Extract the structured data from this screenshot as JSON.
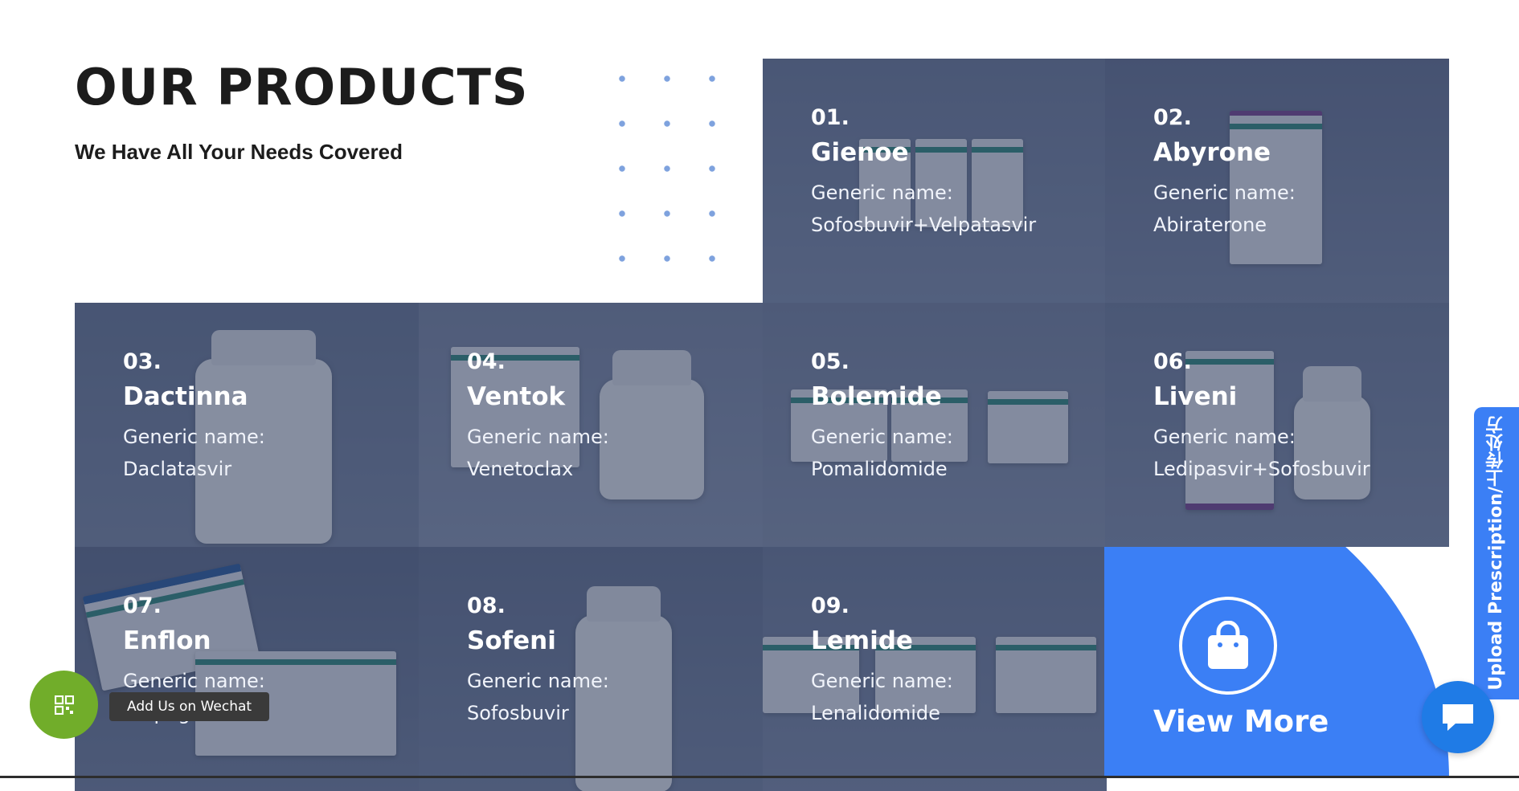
{
  "header": {
    "title": "OUR PRODUCTS",
    "subtitle": "We Have All Your Needs Covered"
  },
  "products": [
    {
      "num": "01.",
      "name": "Gienoe",
      "generic_label": "Generic name:",
      "generic": "Sofosbuvir+Velpatasvir"
    },
    {
      "num": "02.",
      "name": "Abyrone",
      "generic_label": "Generic name:",
      "generic": "Abiraterone"
    },
    {
      "num": "03.",
      "name": "Dactinna",
      "generic_label": "Generic name:",
      "generic": "Daclatasvir"
    },
    {
      "num": "04.",
      "name": "Ventok",
      "generic_label": "Generic name:",
      "generic": "Venetoclax"
    },
    {
      "num": "05.",
      "name": "Bolemide",
      "generic_label": "Generic name:",
      "generic": "Pomalidomide"
    },
    {
      "num": "06.",
      "name": "Liveni",
      "generic_label": "Generic name:",
      "generic": "Ledipasvir+Sofosbuvir"
    },
    {
      "num": "07.",
      "name": "Enflon",
      "generic_label": "Generic name:",
      "generic": "Empagliflozin"
    },
    {
      "num": "08.",
      "name": "Sofeni",
      "generic_label": "Generic name:",
      "generic": "Sofosbuvir"
    },
    {
      "num": "09.",
      "name": "Lemide",
      "generic_label": "Generic name:",
      "generic": "Lenalidomide"
    }
  ],
  "view_more": {
    "label": "View More",
    "icon": "shopping-bag-icon"
  },
  "side_tab": {
    "label": "Upload Prescription/上传处方"
  },
  "wechat": {
    "tooltip": "Add Us on Wechat",
    "icon": "qr-code-icon"
  },
  "chat": {
    "icon": "chat-bubble-icon"
  },
  "colors": {
    "accent": "#3b7ff5",
    "wechat": "#71ad2a",
    "overlay": "#2b395a"
  }
}
